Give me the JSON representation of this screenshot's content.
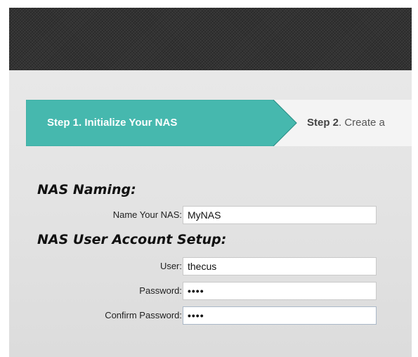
{
  "steps": {
    "step1_label": "Step 1. Initialize Your NAS",
    "step2_prefix": "Step 2",
    "step2_rest": ". Create a"
  },
  "nas_naming": {
    "title": "NAS Naming:",
    "name_label": "Name Your NAS:",
    "name_value": "MyNAS"
  },
  "account_setup": {
    "title": "NAS User Account Setup:",
    "user_label": "User:",
    "user_value": "thecus",
    "password_label": "Password:",
    "password_value": "••••",
    "confirm_label": "Confirm Password:",
    "confirm_value": "••••"
  },
  "colors": {
    "active_step": "#46b8ae",
    "inactive_step": "#f4f4f4",
    "header": "#333333"
  }
}
